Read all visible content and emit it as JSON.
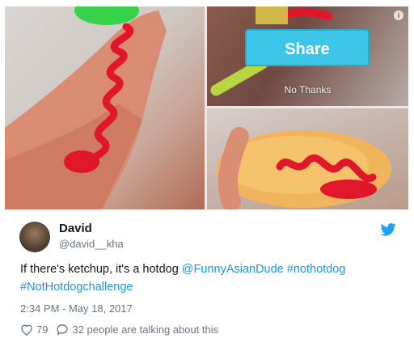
{
  "media": {
    "share_label": "Share",
    "no_thanks_label": "No Thanks",
    "info_label": "i"
  },
  "tweet": {
    "name": "David",
    "handle": "@david__kha",
    "text_plain": "If there's ketchup, it's a hotdog ",
    "mention": "@FunnyAsianDude",
    "hashtag1": "#nothotdog",
    "hashtag2": "#NotHotdogchallenge",
    "timestamp": "2:34 PM - May 18, 2017",
    "likes": "79",
    "talking": "32 people are talking about this"
  },
  "colors": {
    "link": "#1b95e0",
    "twitter_blue": "#1da1f2",
    "share_button": "#3bc6ea",
    "ketchup": "#e0162b"
  },
  "icons": [
    "twitter-bird-icon",
    "heart-icon",
    "comment-bubble-icon",
    "info-icon"
  ]
}
